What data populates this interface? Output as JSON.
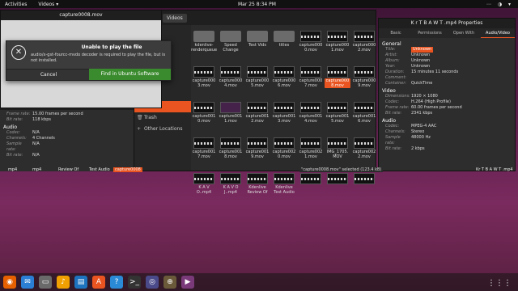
{
  "topbar": {
    "activities": "Activities",
    "app_menu": "Videos ▾",
    "clock": "Mar 25  8:34 PM",
    "tray": "⋯ ◑ ▾"
  },
  "player": {
    "title": "capture0008.mov"
  },
  "dialog": {
    "title": "Unable to play the file",
    "message": "audio/x-gst-fourcc-mvdo decoder is required to play the file, but is not installed.",
    "cancel_label": "Cancel",
    "install_label": "Find in Ubuntu Software"
  },
  "files": {
    "path": "Videos",
    "sidebar": [
      {
        "label": "Videos",
        "icon": "video-icon",
        "active": true
      },
      {
        "label": "Trash",
        "icon": "trash-icon",
        "active": false
      },
      {
        "label": "Other Locations",
        "icon": "plus-icon",
        "active": false
      }
    ],
    "items": [
      {
        "name": "kdenlive-renderqueue",
        "kind": "folder"
      },
      {
        "name": "Speed Change",
        "kind": "folder"
      },
      {
        "name": "Test Vids",
        "kind": "folder"
      },
      {
        "name": "titles",
        "kind": "folder"
      },
      {
        "name": "capture000 0.mov",
        "kind": "video"
      },
      {
        "name": "capture000 1.mov",
        "kind": "video"
      },
      {
        "name": "capture000 2.mov",
        "kind": "video"
      },
      {
        "name": "capture000 3.mov",
        "kind": "video"
      },
      {
        "name": "capture000 4.mov",
        "kind": "video"
      },
      {
        "name": "capture000 5.mov",
        "kind": "video"
      },
      {
        "name": "capture000 6.mov",
        "kind": "video"
      },
      {
        "name": "capture000 7.mov",
        "kind": "video"
      },
      {
        "name": "capture000 8.mov",
        "kind": "video",
        "selected": true
      },
      {
        "name": "capture000 9.mov",
        "kind": "video"
      },
      {
        "name": "capture001 0.mov",
        "kind": "video"
      },
      {
        "name": "capture001 1.mov",
        "kind": "purple"
      },
      {
        "name": "capture001 2.mov",
        "kind": "video"
      },
      {
        "name": "capture001 3.mov",
        "kind": "video"
      },
      {
        "name": "capture001 4.mov",
        "kind": "video"
      },
      {
        "name": "capture001 5.mov",
        "kind": "video"
      },
      {
        "name": "capture001 6.mov",
        "kind": "video"
      },
      {
        "name": "capture001 7.mov",
        "kind": "video"
      },
      {
        "name": "capture001 8.mov",
        "kind": "video"
      },
      {
        "name": "capture001 9.mov",
        "kind": "video"
      },
      {
        "name": "capture002 0.mov",
        "kind": "video"
      },
      {
        "name": "capture002 1.mov",
        "kind": "video"
      },
      {
        "name": "IMG_1705. MOV",
        "kind": "video"
      },
      {
        "name": "capture002 2.mov",
        "kind": "video"
      },
      {
        "name": "K A V O..mp4",
        "kind": "video"
      },
      {
        "name": "K A V O J..mp4",
        "kind": "video"
      },
      {
        "name": "Kdenlive Review Of",
        "kind": "video"
      },
      {
        "name": "Kdenlive Test Audio",
        "kind": "video"
      },
      {
        "name": "",
        "kind": "video"
      },
      {
        "name": "",
        "kind": "video"
      },
      {
        "name": "",
        "kind": "video"
      }
    ]
  },
  "properties": {
    "title": "K r T B A W T .mp4 Properties",
    "tabs": [
      "Basic",
      "Permissions",
      "Open With",
      "Audio/Video"
    ],
    "general_heading": "General",
    "general": [
      {
        "k": "Title:",
        "v": "Unknown",
        "hl": true
      },
      {
        "k": "Artist:",
        "v": "Unknown"
      },
      {
        "k": "Album:",
        "v": "Unknown"
      },
      {
        "k": "Year:",
        "v": "Unknown"
      },
      {
        "k": "Duration:",
        "v": "15 minutes 11 seconds"
      },
      {
        "k": "Comment:",
        "v": ""
      },
      {
        "k": "Container:",
        "v": "QuickTime"
      }
    ],
    "video_heading": "Video",
    "video": [
      {
        "k": "Dimensions:",
        "v": "1920 × 1080"
      },
      {
        "k": "Codec:",
        "v": "H.264 (High Profile)"
      },
      {
        "k": "Frame rate:",
        "v": "60.00 frames per second"
      },
      {
        "k": "Bit rate:",
        "v": "2341 kbps"
      }
    ],
    "audio_heading": "Audio",
    "audio": [
      {
        "k": "Codec:",
        "v": "MPEG-4 AAC"
      },
      {
        "k": "Channels:",
        "v": "Stereo"
      },
      {
        "k": "Sample rate:",
        "v": "48000 Hz"
      },
      {
        "k": "Bit rate:",
        "v": "2 kbps"
      }
    ]
  },
  "props2": {
    "video_rows": [
      {
        "k": "Frame rate:",
        "v": "15.00 frames per second"
      },
      {
        "k": "Bit rate:",
        "v": "118 kbps"
      }
    ],
    "audio_heading": "Audio",
    "audio": [
      {
        "k": "Codec:",
        "v": "N/A"
      },
      {
        "k": "Channels:",
        "v": "4 Channels"
      },
      {
        "k": "Sample rate:",
        "v": "N/A"
      },
      {
        "k": "Bit rate:",
        "v": "N/A"
      }
    ]
  },
  "desktop_labels": [
    {
      "text": "mp4"
    },
    {
      "text": "mp4"
    },
    {
      "text": "Review Of"
    },
    {
      "text": "Test Audio"
    },
    {
      "text": "capture0008",
      "hl": true
    }
  ],
  "statusbar": "\"capture0008.mov\" selected (123.4 kB)",
  "desk_right_label": "Kr T B A W T .mp4",
  "dock": {
    "icons": [
      "firefox-icon",
      "thunderbird-icon",
      "files-icon",
      "rhythmbox-icon",
      "writer-icon",
      "software-icon",
      "help-icon",
      "terminal-icon",
      "screenshot-icon",
      "crosshair-icon",
      "videos-icon"
    ],
    "grid": "⋮⋮⋮"
  }
}
